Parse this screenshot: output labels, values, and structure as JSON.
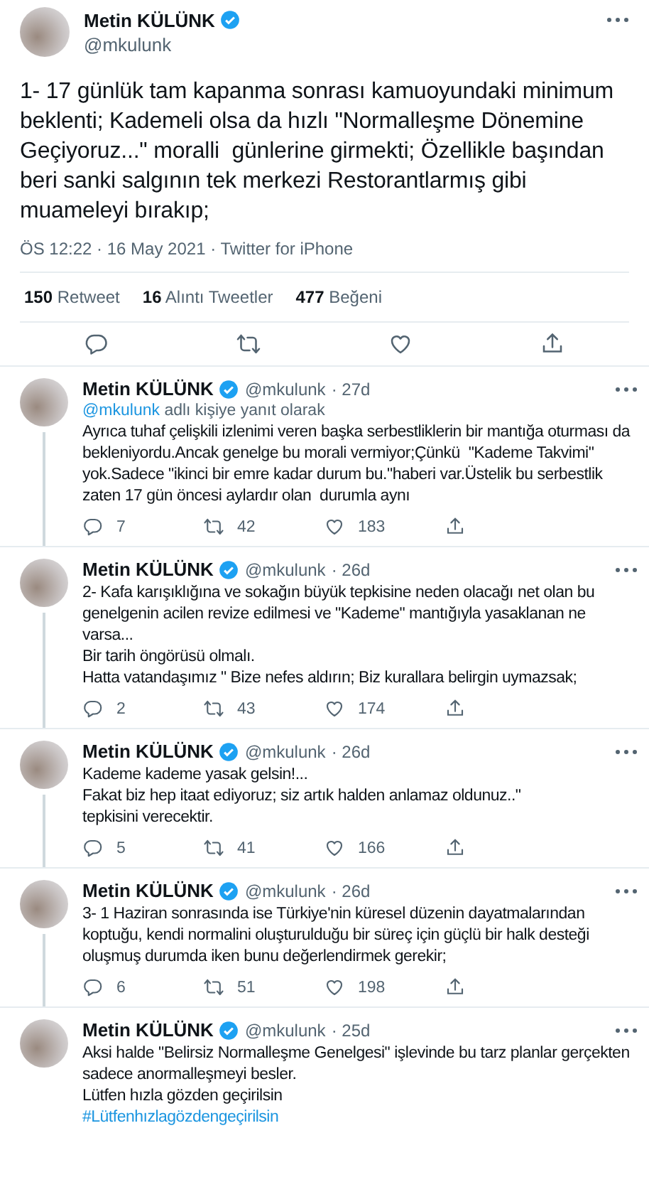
{
  "main_tweet": {
    "author": "Metin KÜLÜNK",
    "handle": "@mkulunk",
    "verified": true,
    "text": "1- 17 günlük tam kapanma sonrası kamuoyundaki minimum beklenti; Kademeli olsa da hızlı \"Normalleşme Dönemine Geçiyoruz...\" moralli  günlerine girmekti; Özellikle başından beri sanki salgının tek merkezi Restorantlarmış gibi muameleyi bırakıp;",
    "meta": "ÖS 12:22 · 16 May 2021 · Twitter for iPhone",
    "stats": [
      "**150** Retweet",
      "**16** Alıntı Tweetler",
      "**477** Beğeni"
    ]
  },
  "replies": [
    {
      "author": "Metin KÜLÜNK",
      "verified": true,
      "handle": "@mkulunk",
      "age": "· 27d",
      "reply_to": {
        "handle": "@mkulunk",
        "text": "adlı kişiye yanıt olarak"
      },
      "text": "Ayrıca tuhaf çelişkili izlenimi veren başka serbestliklerin bir mantığa oturması da bekleniyordu.Ancak genelge bu morali vermiyor;Çünkü  \"Kademe Takvimi\" yok.Sadece \"ikinci bir emre kadar durum bu.\"haberi var.Üstelik bu serbestlik zaten 17 gün öncesi aylardır olan  durumla aynı",
      "counts": [
        "7",
        "42",
        "183"
      ]
    },
    {
      "author": "Metin KÜLÜNK",
      "verified": true,
      "handle": "@mkulunk",
      "age": "· 26d",
      "text": "2- Kafa karışıklığına ve sokağın büyük tepkisine neden olacağı net olan bu genelgenin acilen revize edilmesi ve \"Kademe\" mantığıyla yasaklanan ne varsa...\nBir tarih öngörüsü olmalı.\nHatta vatandaşımız \" Bize nefes aldırın; Biz kurallara belirgin uymazsak;",
      "counts": [
        "2",
        "43",
        "174"
      ]
    },
    {
      "author": "Metin KÜLÜNK",
      "verified": true,
      "handle": "@mkulunk",
      "age": "· 26d",
      "text": "Kademe kademe yasak gelsin!...\nFakat biz hep itaat ediyoruz; siz artık halden anlamaz oldunuz..\"\ntepkisini verecektir.",
      "counts": [
        "5",
        "41",
        "166"
      ]
    },
    {
      "author": "Metin KÜLÜNK",
      "verified": true,
      "handle": "@mkulunk",
      "age": "· 26d",
      "text": "3- 1 Haziran sonrasında ise Türkiye'nin küresel düzenin dayatmalarından koptuğu, kendi normalini oluşturulduğu bir süreç için güçlü bir halk desteği oluşmuş durumda iken bunu değerlendirmek gerekir;",
      "counts": [
        "6",
        "51",
        "198"
      ]
    },
    {
      "author": "Metin KÜLÜNK",
      "verified": true,
      "handle": "@mkulunk",
      "age": "· 25d",
      "text": "Aksi halde \"Belirsiz Normalleşme Genelgesi\" işlevinde bu tarz planlar gerçekten sadece anormalleşmeyi besler.\nLütfen hızla gözden geçirilsin",
      "hashtag": "#Lütfenhızlagözdengeçirilsin"
    }
  ]
}
